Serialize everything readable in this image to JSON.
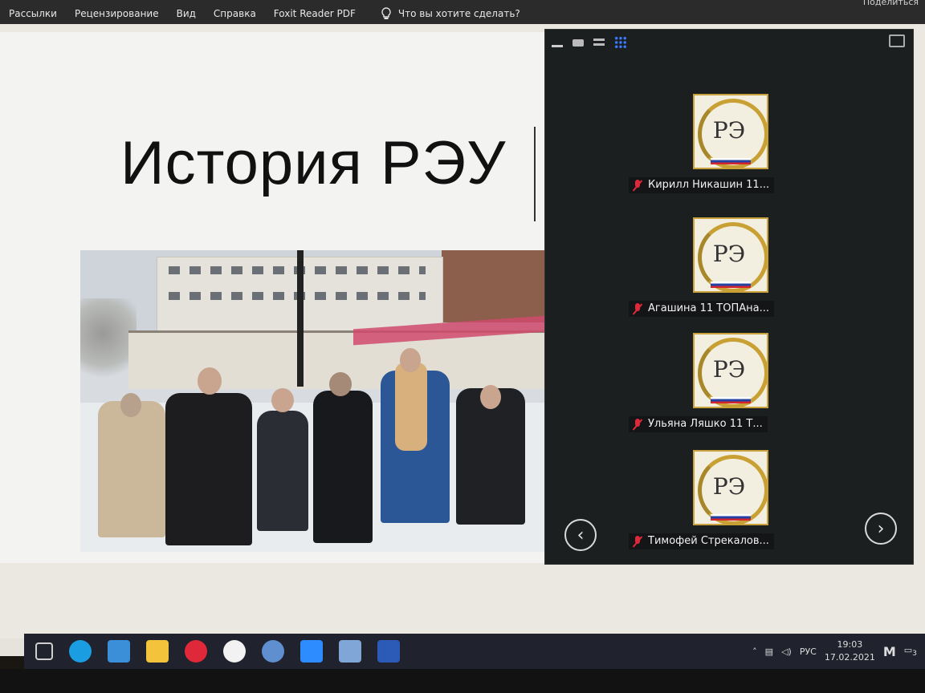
{
  "ribbon": {
    "tabs": [
      "Рассылки",
      "Рецензирование",
      "Вид",
      "Справка",
      "Foxit Reader PDF"
    ],
    "tell_me": "Что вы хотите сделать?",
    "share": "Поделиться"
  },
  "slide": {
    "title": "История РЭУ"
  },
  "zoom": {
    "participants": [
      {
        "name": "Кирилл Никашин 11...",
        "muted": true
      },
      {
        "name": "Агашина 11 ТОПАна...",
        "muted": true
      },
      {
        "name": "Ульяна Ляшко 11 Т...",
        "muted": true
      },
      {
        "name": "Тимофей Стрекалов...",
        "muted": true
      }
    ],
    "logo_monogram": "РЭ",
    "prev_label": "‹",
    "next_label": "›"
  },
  "taskbar": {
    "language": "РУС",
    "time": "19:03",
    "date": "17.02.2021",
    "notification_count": "3",
    "apps": [
      "task-view",
      "edge",
      "mail",
      "file-explorer",
      "opera",
      "yandex-browser",
      "vk",
      "zoom",
      "photos",
      "word"
    ],
    "colors": {
      "edge": "#1b9de2",
      "mail": "#3a8fd8",
      "explorer": "#f4c33c",
      "opera": "#e0283b",
      "yandex": "#f2f2f2",
      "zoom": "#2d8cff",
      "word": "#2b5bb7"
    }
  }
}
